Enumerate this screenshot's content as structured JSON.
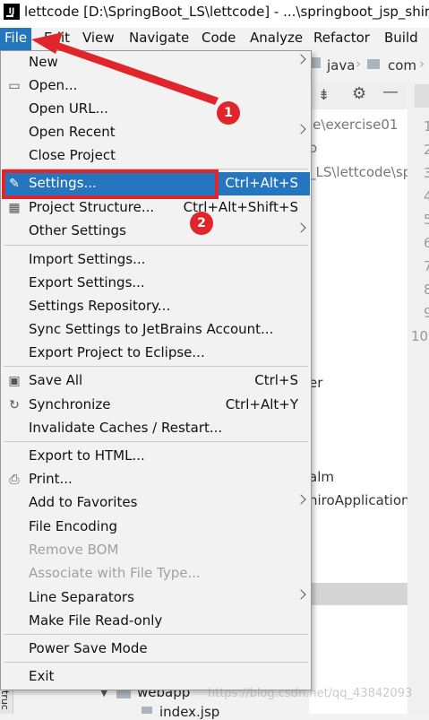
{
  "window": {
    "title": "lettcode [D:\\SpringBoot_LS\\lettcode] - ...\\springboot_jsp_shiro"
  },
  "menubar": [
    "File",
    "Edit",
    "View",
    "Navigate",
    "Code",
    "Analyze",
    "Refactor",
    "Build"
  ],
  "navbar": {
    "crumb1": "java",
    "crumb2": "com"
  },
  "background": {
    "path1": "le\\exercise01",
    "path2": "o",
    "path3": "_LS\\lettcode\\sp",
    "item_er": "er",
    "item_alm": "alm",
    "item_app": "hiroApplication",
    "tree_webapp": "webapp",
    "tree_index": "index.jsp",
    "line_numbers": [
      "1",
      "2",
      "3",
      "4",
      "5",
      "6",
      "7",
      "8",
      "9",
      "10"
    ],
    "edge_text": "truc"
  },
  "file_menu": {
    "items": [
      {
        "label": "New",
        "shortcut": "",
        "submenu": true
      },
      {
        "label": "Open...",
        "shortcut": "",
        "icon": "folder-icon"
      },
      {
        "label": "Open URL...",
        "shortcut": ""
      },
      {
        "label": "Open Recent",
        "shortcut": "",
        "submenu": true
      },
      {
        "label": "Close Project",
        "shortcut": ""
      },
      {
        "label": "Settings...",
        "shortcut": "Ctrl+Alt+S",
        "icon": "wrench-icon",
        "selected": true
      },
      {
        "label": "Project Structure...",
        "shortcut": "Ctrl+Alt+Shift+S",
        "icon": "structure-icon"
      },
      {
        "label": "Other Settings",
        "shortcut": "",
        "submenu": true
      },
      {
        "label": "Import Settings...",
        "shortcut": ""
      },
      {
        "label": "Export Settings...",
        "shortcut": ""
      },
      {
        "label": "Settings Repository...",
        "shortcut": ""
      },
      {
        "label": "Sync Settings to JetBrains Account...",
        "shortcut": ""
      },
      {
        "label": "Export Project to Eclipse...",
        "shortcut": ""
      },
      {
        "label": "Save All",
        "shortcut": "Ctrl+S",
        "icon": "save-icon"
      },
      {
        "label": "Synchronize",
        "shortcut": "Ctrl+Alt+Y",
        "icon": "refresh-icon"
      },
      {
        "label": "Invalidate Caches / Restart...",
        "shortcut": ""
      },
      {
        "label": "Export to HTML...",
        "shortcut": ""
      },
      {
        "label": "Print...",
        "shortcut": "",
        "icon": "printer-icon"
      },
      {
        "label": "Add to Favorites",
        "shortcut": "",
        "submenu": true
      },
      {
        "label": "File Encoding",
        "shortcut": ""
      },
      {
        "label": "Remove BOM",
        "shortcut": "",
        "disabled": true
      },
      {
        "label": "Associate with File Type...",
        "shortcut": "",
        "disabled": true
      },
      {
        "label": "Line Separators",
        "shortcut": "",
        "submenu": true
      },
      {
        "label": "Make File Read-only",
        "shortcut": ""
      },
      {
        "label": "Power Save Mode",
        "shortcut": ""
      },
      {
        "label": "Exit",
        "shortcut": ""
      }
    ]
  },
  "annotations": {
    "badge1": "1",
    "badge2": "2",
    "highlight_color": "#e0252b"
  },
  "watermark": "https://blog.csdn.net/qq_43842093",
  "colors": {
    "selection": "#2675bf",
    "menu_bg": "#f2f2f2"
  }
}
